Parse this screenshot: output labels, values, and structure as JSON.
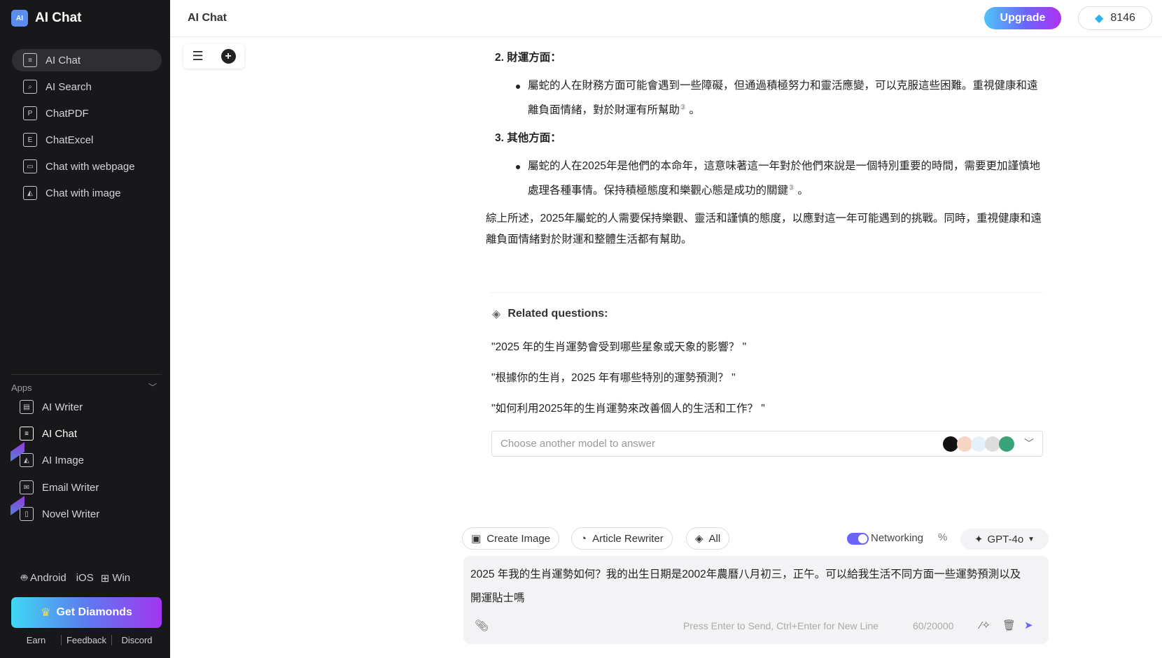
{
  "app": {
    "name": "AI Chat",
    "logo_text": "AI"
  },
  "sidebar": {
    "items": [
      {
        "label": "AI Chat",
        "icon": "chat-icon",
        "active": true
      },
      {
        "label": "AI Search",
        "icon": "search-icon"
      },
      {
        "label": "ChatPDF",
        "icon": "pdf-icon"
      },
      {
        "label": "ChatExcel",
        "icon": "excel-icon"
      },
      {
        "label": "Chat with webpage",
        "icon": "webpage-icon"
      },
      {
        "label": "Chat with image",
        "icon": "image-icon"
      }
    ],
    "apps_label": "Apps",
    "apps": [
      {
        "label": "AI Writer",
        "icon": "writer-icon"
      },
      {
        "label": "AI Chat",
        "icon": "chat-icon",
        "active": true
      },
      {
        "label": "AI Image",
        "icon": "image-icon",
        "badge": "new"
      },
      {
        "label": "Email Writer",
        "icon": "email-icon"
      },
      {
        "label": "Novel Writer",
        "icon": "novel-icon",
        "badge": "new"
      }
    ],
    "platforms": [
      "Android",
      "iOS",
      "Win"
    ],
    "get_diamonds": "Get Diamonds",
    "footer": [
      "Earn",
      "Feedback",
      "Discord"
    ]
  },
  "header": {
    "title": "AI Chat",
    "upgrade": "Upgrade",
    "diamonds": "8146"
  },
  "answer": {
    "sections": [
      {
        "heading": "2. 財運方面：",
        "bullet": "屬蛇的人在財務方面可能會遇到一些障礙，但通過積極努力和靈活應變，可以克服這些困難。重視健康和遠離負面情緒，對於財運有所幫助",
        "cite": "3"
      },
      {
        "heading": "3. 其他方面：",
        "bullet": "屬蛇的人在2025年是他們的本命年，這意味著這一年對於他們來說是一個特別重要的時間，需要更加謹慎地處理各種事情。保持積極態度和樂觀心態是成功的關鍵",
        "cite": "3"
      }
    ],
    "summary": "綜上所述，2025年屬蛇的人需要保持樂觀、靈活和謹慎的態度，以應對這一年可能遇到的挑戰。同時，重視健康和遠離負面情緒對於財運和整體生活都有幫助。"
  },
  "related": {
    "heading": "Related questions:",
    "questions": [
      "\"2025 年的生肖運勢會受到哪些星象或天象的影響？ \"",
      "\"根據你的生肖，2025 年有哪些特別的運勢預測？ \"",
      "\"如何利用2025年的生肖運勢來改善個人的生活和工作？ \""
    ],
    "model_placeholder": "Choose another model to answer"
  },
  "toolbar": {
    "create_image": "Create Image",
    "article_rewriter": "Article Rewriter",
    "all": "All",
    "networking": "Networking",
    "networking_on": true,
    "model": "GPT-4o"
  },
  "input": {
    "value": "2025 年我的生肖運勢如何？我的出生日期是2002年農曆八月初三，正午。可以給我生活不同方面一些運勢預測以及開運貼士嗎",
    "hint": "Press Enter to Send, Ctrl+Enter for New Line",
    "count": "60/20000"
  },
  "colors": {
    "accent": "#6c63ff",
    "sidebar_bg": "#18181b"
  }
}
